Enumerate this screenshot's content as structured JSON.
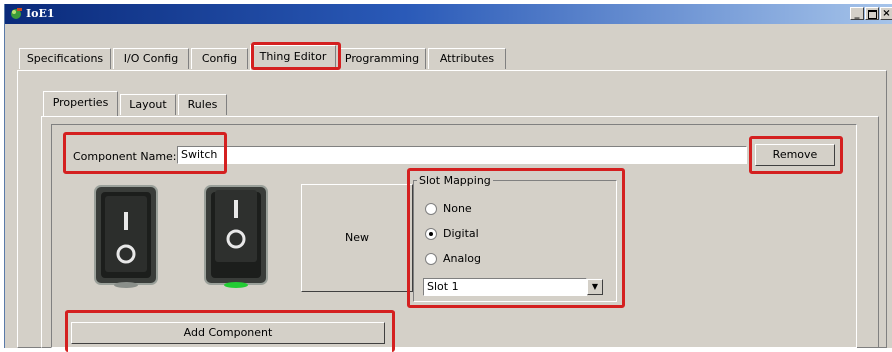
{
  "window": {
    "title": "IoE1"
  },
  "main_tabs": [
    {
      "label": "Specifications"
    },
    {
      "label": "I/O Config"
    },
    {
      "label": "Config"
    },
    {
      "label": "Thing Editor"
    },
    {
      "label": "Programming"
    },
    {
      "label": "Attributes"
    }
  ],
  "active_main_tab": "Thing Editor",
  "sub_tabs": [
    {
      "label": "Properties"
    },
    {
      "label": "Layout"
    },
    {
      "label": "Rules"
    }
  ],
  "active_sub_tab": "Properties",
  "component": {
    "name_label": "Component Name:",
    "name_value": "Switch",
    "remove_label": "Remove",
    "new_label": "New",
    "add_label": "Add Component",
    "images": [
      {
        "name": "switch-off-image",
        "led_color": "#8a8f8a"
      },
      {
        "name": "switch-on-image",
        "led_color": "#22cc33"
      }
    ]
  },
  "slot_mapping": {
    "title": "Slot Mapping",
    "options": [
      {
        "label": "None",
        "selected": false
      },
      {
        "label": "Digital",
        "selected": true
      },
      {
        "label": "Analog",
        "selected": false
      }
    ],
    "slot_value": "Slot 1"
  },
  "colors": {
    "highlight": "#d42020",
    "window_bg": "#d4d0c8",
    "title_dark": "#0a2a7a"
  }
}
